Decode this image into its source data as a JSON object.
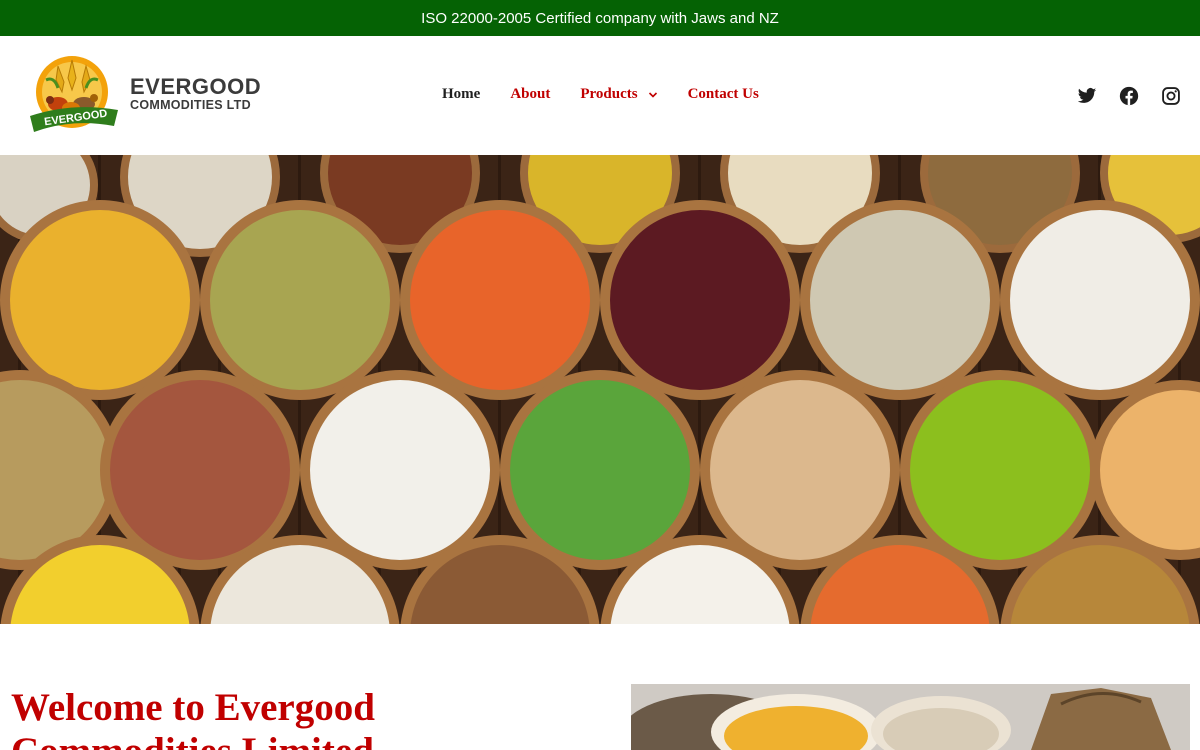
{
  "topbar": {
    "text": "ISO 22000-2005 Certified company with Jaws and NZ"
  },
  "logo": {
    "badge_text": "EVERGOOD",
    "name": "EVERGOOD",
    "subtitle": "COMMODITIES LTD"
  },
  "nav": {
    "items": [
      {
        "label": "Home",
        "active": true
      },
      {
        "label": "About"
      },
      {
        "label": "Products",
        "has_dropdown": true
      },
      {
        "label": "Contact Us"
      }
    ]
  },
  "social": {
    "icons": [
      "twitter-icon",
      "facebook-icon",
      "instagram-icon"
    ]
  },
  "hero": {
    "image": "bowls-of-grains-and-legumes"
  },
  "welcome": {
    "heading": "Welcome to Evergood Commodities Limited"
  },
  "side_image": {
    "image": "bowls-of-corn-and-beans-with-sacks"
  },
  "colors": {
    "topbar_bg": "#056204",
    "accent_red": "#c00000",
    "text_dark": "#1f1f1f"
  }
}
